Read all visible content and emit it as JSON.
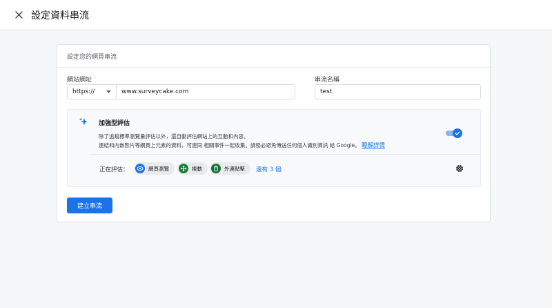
{
  "header": {
    "title": "設定資料串流"
  },
  "card": {
    "title": "設定您的網頁串流",
    "website_url_label": "網站網址",
    "protocol_value": "https://",
    "url_value": "www.surveycake.com",
    "stream_name_label": "串流名稱",
    "stream_name_value": "test"
  },
  "enhanced_measurement": {
    "title": "加強型評估",
    "desc_line1": "除了追蹤標準瀏覽量評估以外，還自動評估網站上的互動和內容。",
    "desc_line2": "連結和內嵌影片等網頁上元素的資料，可連同 相關事件一起收集。請務必避免傳送任何個人識別資訊 給 Google。",
    "learn_more": "瞭解詳情",
    "enabled": true,
    "measuring_label": "正在評估：",
    "chips": [
      {
        "label": "網頁瀏覽",
        "icon": "eye-icon"
      },
      {
        "label": "捲動",
        "icon": "scroll-icon"
      },
      {
        "label": "外連點擊",
        "icon": "mouse-icon"
      }
    ],
    "more_link": "還有 3 個"
  },
  "actions": {
    "create_label": "建立串流"
  },
  "colors": {
    "accent": "#1a73e8",
    "chip_eye": "#1a73e8",
    "chip_scroll": "#188038",
    "chip_click": "#137333"
  }
}
